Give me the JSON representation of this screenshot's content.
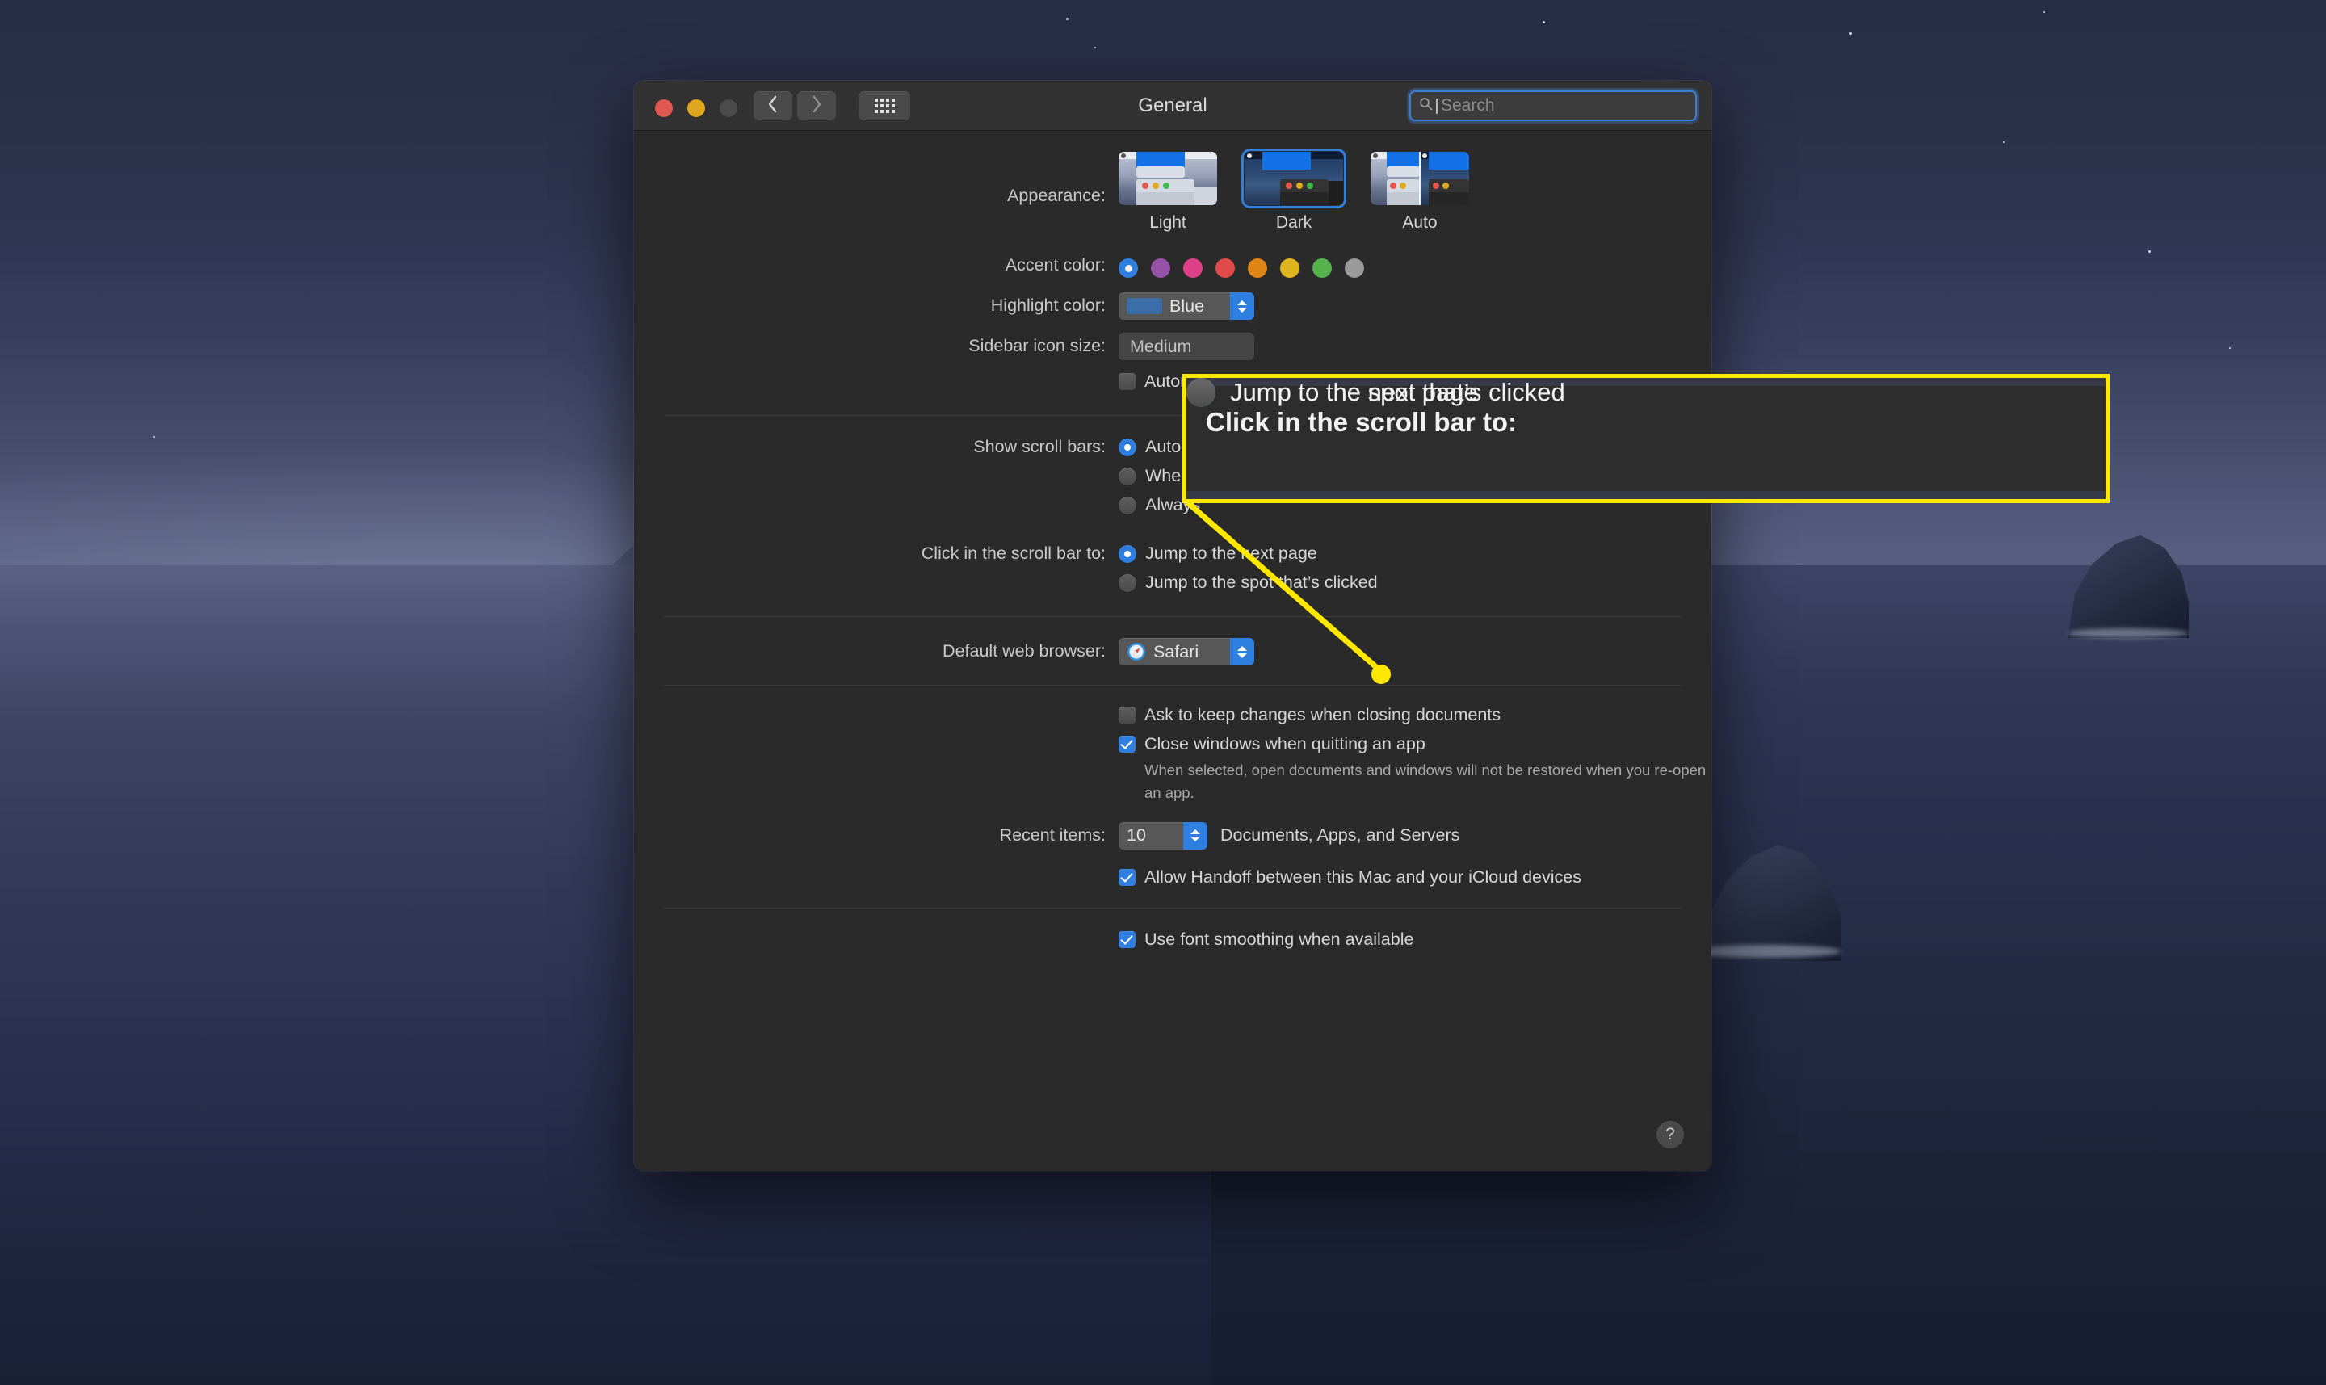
{
  "window": {
    "title": "General",
    "traffic_lights": [
      "close",
      "minimize",
      "zoom"
    ],
    "nav": {
      "back_icon": "chevron-left-icon",
      "forward_icon": "chevron-right-icon",
      "grid_icon": "show-all-grid-icon"
    },
    "search": {
      "placeholder": "Search",
      "value": "",
      "icon": "search-icon"
    }
  },
  "appearance": {
    "label": "Appearance:",
    "options": [
      {
        "id": "light",
        "label": "Light",
        "selected": false
      },
      {
        "id": "dark",
        "label": "Dark",
        "selected": true
      },
      {
        "id": "auto",
        "label": "Auto",
        "selected": false
      }
    ]
  },
  "accent": {
    "label": "Accent color:",
    "selected_index": 0,
    "swatches": [
      {
        "name": "blue",
        "hex": "#2f7fe0"
      },
      {
        "name": "purple",
        "hex": "#9552a8"
      },
      {
        "name": "pink",
        "hex": "#e0408a"
      },
      {
        "name": "red",
        "hex": "#e04a4a"
      },
      {
        "name": "orange",
        "hex": "#e08416"
      },
      {
        "name": "yellow",
        "hex": "#e0b41c"
      },
      {
        "name": "green",
        "hex": "#56b24c"
      },
      {
        "name": "graphite",
        "hex": "#9a9a9a"
      }
    ]
  },
  "highlight": {
    "label": "Highlight color:",
    "value": "Blue",
    "chip_hex": "#3b6ea8"
  },
  "sidebar_icon_size": {
    "label": "Sidebar icon size:",
    "value": "Medium"
  },
  "menubar_auto_hide": {
    "label": "Automatically hide and show the menu bar",
    "checked": false
  },
  "show_scroll_bars": {
    "label": "Show scroll bars:",
    "options": [
      {
        "label": "Automatically based on mouse or trackpad",
        "selected": true
      },
      {
        "label": "When scrolling",
        "selected": false
      },
      {
        "label": "Always",
        "selected": false
      }
    ]
  },
  "click_scroll_bar": {
    "label": "Click in the scroll bar to:",
    "options": [
      {
        "label": "Jump to the next page",
        "selected": true
      },
      {
        "label": "Jump to the spot that’s clicked",
        "selected": false
      }
    ]
  },
  "default_browser": {
    "label": "Default web browser:",
    "value": "Safari",
    "icon": "safari-compass-icon"
  },
  "documents": {
    "ask_keep_changes": {
      "label": "Ask to keep changes when closing documents",
      "checked": false
    },
    "close_windows": {
      "label": "Close windows when quitting an app",
      "checked": true
    },
    "close_windows_hint": "When selected, open documents and windows will not be restored when you re-open an app."
  },
  "recent_items": {
    "label": "Recent items:",
    "value": "10",
    "suffix": "Documents, Apps, and Servers"
  },
  "handoff": {
    "label": "Allow Handoff between this Mac and your iCloud devices",
    "checked": true
  },
  "font_smoothing": {
    "label": "Use font smoothing when available",
    "checked": true
  },
  "help_button": {
    "label": "?"
  },
  "callout": {
    "border_hex": "#ffe800",
    "label": "Click in the scroll bar to:",
    "options": [
      {
        "label": "Jump to the next page",
        "selected": true
      },
      {
        "label": "Jump to the spot that’s clicked",
        "selected": false
      }
    ]
  }
}
